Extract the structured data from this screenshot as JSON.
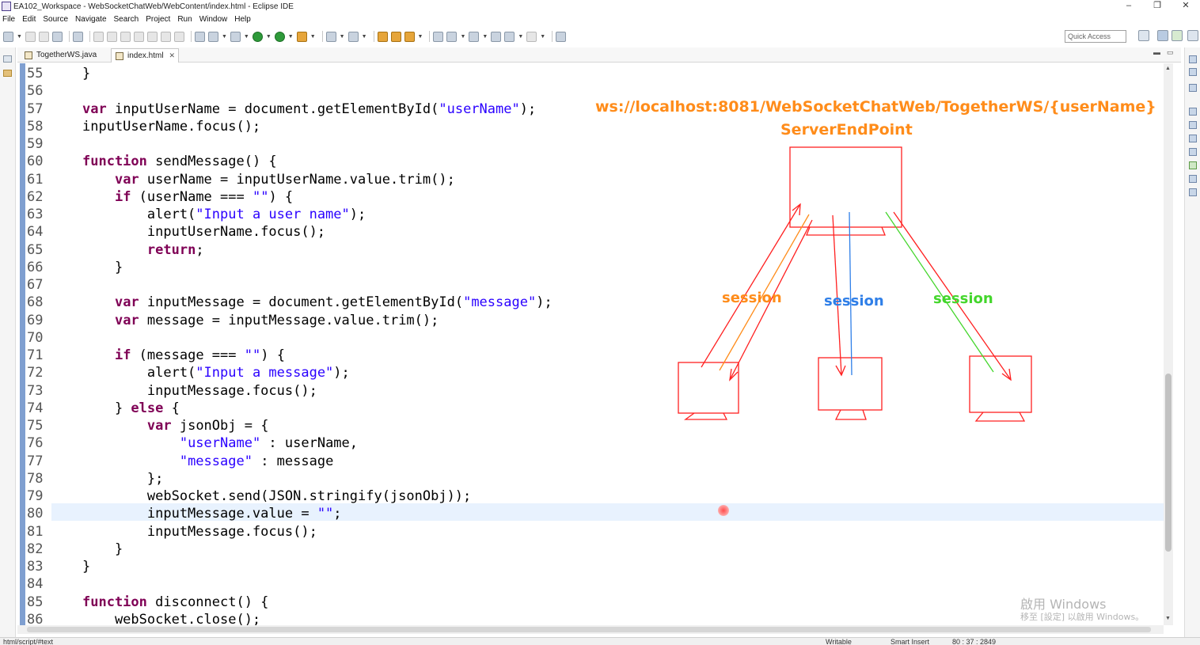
{
  "window": {
    "title": "EA102_Workspace - WebSocketChatWeb/WebContent/index.html - Eclipse IDE",
    "controls": [
      "–",
      "❐",
      "✕"
    ]
  },
  "menu": [
    "File",
    "Edit",
    "Source",
    "Navigate",
    "Search",
    "Project",
    "Run",
    "Window",
    "Help"
  ],
  "toolbar": {
    "quick_access_placeholder": "Quick Access"
  },
  "tabs": [
    {
      "label": "TogetherWS.java",
      "active": false
    },
    {
      "label": "index.html",
      "active": true,
      "close": "✕"
    }
  ],
  "editor": {
    "current_line": 80,
    "lines": [
      {
        "n": "55",
        "text": "    }"
      },
      {
        "n": "56",
        "text": ""
      },
      {
        "n": "57",
        "text": "    var inputUserName = document.getElementById(\"userName\");"
      },
      {
        "n": "58",
        "text": "    inputUserName.focus();"
      },
      {
        "n": "59",
        "text": ""
      },
      {
        "n": "60",
        "text": "    function sendMessage() {"
      },
      {
        "n": "61",
        "text": "        var userName = inputUserName.value.trim();"
      },
      {
        "n": "62",
        "text": "        if (userName === \"\") {"
      },
      {
        "n": "63",
        "text": "            alert(\"Input a user name\");"
      },
      {
        "n": "64",
        "text": "            inputUserName.focus();"
      },
      {
        "n": "65",
        "text": "            return;"
      },
      {
        "n": "66",
        "text": "        }"
      },
      {
        "n": "67",
        "text": ""
      },
      {
        "n": "68",
        "text": "        var inputMessage = document.getElementById(\"message\");"
      },
      {
        "n": "69",
        "text": "        var message = inputMessage.value.trim();"
      },
      {
        "n": "70",
        "text": ""
      },
      {
        "n": "71",
        "text": "        if (message === \"\") {"
      },
      {
        "n": "72",
        "text": "            alert(\"Input a message\");"
      },
      {
        "n": "73",
        "text": "            inputMessage.focus();"
      },
      {
        "n": "74",
        "text": "        } else {"
      },
      {
        "n": "75",
        "text": "            var jsonObj = {"
      },
      {
        "n": "76",
        "text": "                \"userName\" : userName,"
      },
      {
        "n": "77",
        "text": "                \"message\" : message"
      },
      {
        "n": "78",
        "text": "            };"
      },
      {
        "n": "79",
        "text": "            webSocket.send(JSON.stringify(jsonObj));"
      },
      {
        "n": "80",
        "text": "            inputMessage.value = \"\";"
      },
      {
        "n": "81",
        "text": "            inputMessage.focus();"
      },
      {
        "n": "82",
        "text": "        }"
      },
      {
        "n": "83",
        "text": "    }"
      },
      {
        "n": "84",
        "text": ""
      },
      {
        "n": "85",
        "text": "    function disconnect() {"
      },
      {
        "n": "86",
        "text": "        webSocket.close();"
      }
    ]
  },
  "diagram": {
    "url": "ws://localhost:8081/WebSocketChatWeb/TogetherWS/{userName}",
    "server_label": "ServerEndPoint",
    "sessions": [
      {
        "label": "session",
        "color": "#ff8c1a"
      },
      {
        "label": "session",
        "color": "#2f7fe8"
      },
      {
        "label": "session",
        "color": "#44d62c"
      }
    ],
    "draw_color": "#ff2020"
  },
  "status": {
    "path": "html/script/#text",
    "mode": "Writable",
    "insert": "Smart Insert",
    "position": "80 : 37 : 2849"
  },
  "watermark": {
    "line1": "啟用 Windows",
    "line2": "移至 [設定] 以啟用 Windows。"
  },
  "colors": {
    "keyword": "#7f0055",
    "string": "#2a00ff",
    "current_line": "#e8f2fe"
  }
}
